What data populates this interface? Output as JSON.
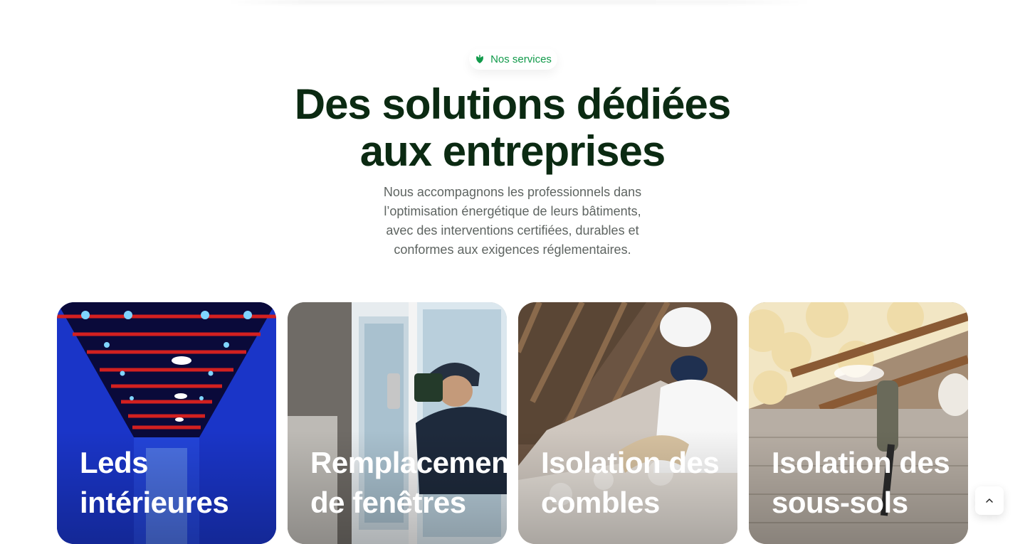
{
  "section": {
    "badge_label": "Nos services",
    "badge_icon": "leaf-icon",
    "title_line1": "Des solutions dédiées",
    "title_line2": "aux entreprises",
    "description": "Nous accompagnons les professionnels dans l’optimisation énergétique de leurs bâtiments, avec des interventions certifiées, durables et conformes aux exigences réglementaires."
  },
  "services": [
    {
      "line1": "Leds",
      "line2": "intérieures",
      "image": "warehouse-led-lighting-photo"
    },
    {
      "line1": "Remplacement",
      "line2": "de fenêtres",
      "image": "window-installer-photo"
    },
    {
      "line1": "Isolation des",
      "line2": "combles",
      "image": "attic-insulation-photo"
    },
    {
      "line1": "Isolation des",
      "line2": "sous-sols",
      "image": "spray-foam-insulation-photo"
    }
  ],
  "scroll_top": {
    "icon": "chevron-up-icon"
  },
  "colors": {
    "accent": "#119a4a",
    "title": "#0b2a12",
    "body_text": "#5e6461",
    "background": "#ffffff"
  }
}
